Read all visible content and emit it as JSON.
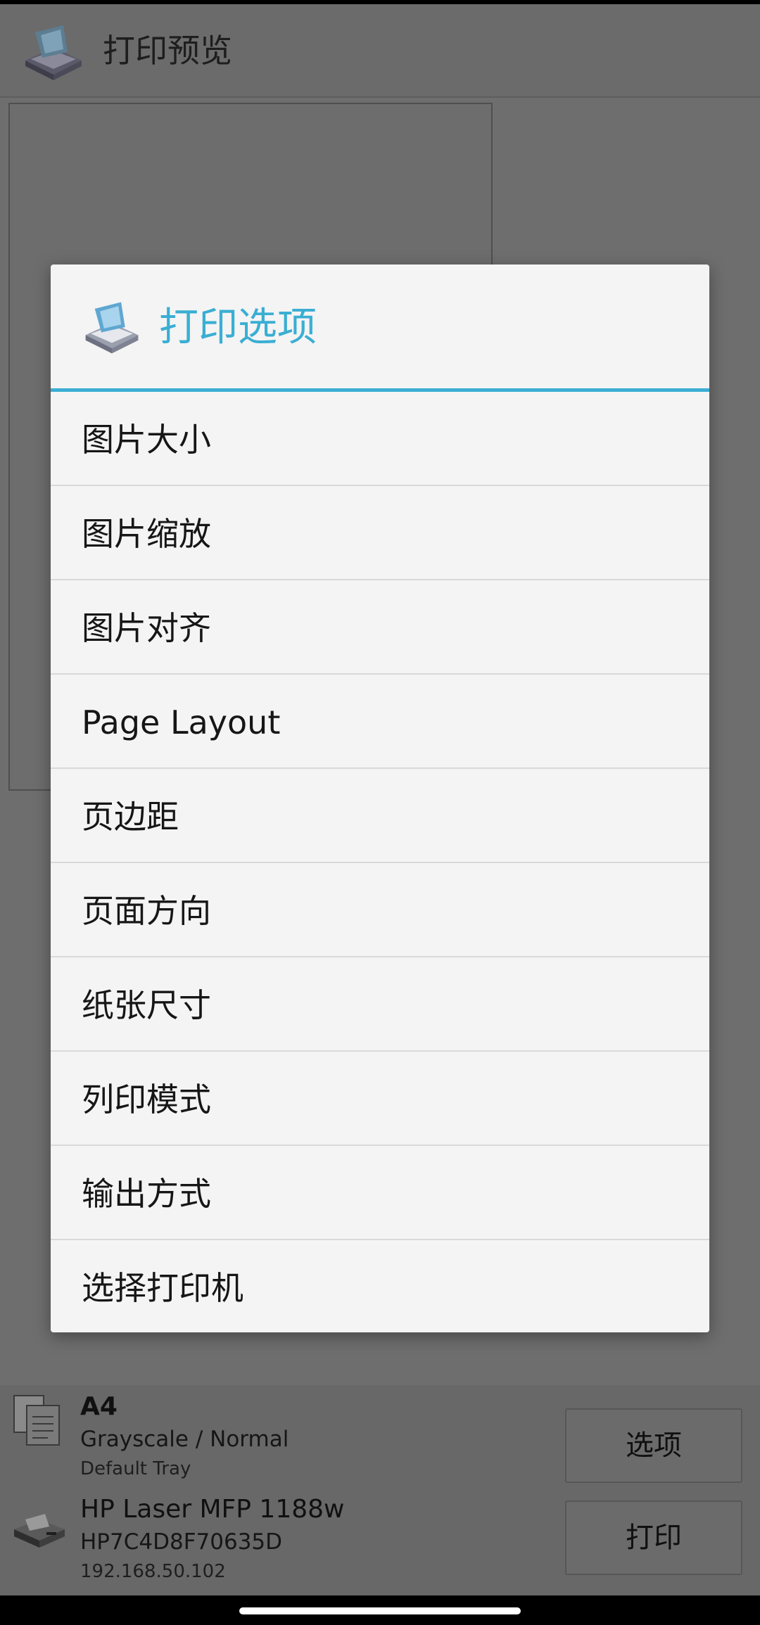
{
  "app": {
    "title": "打印预览",
    "icon": "printer-app-icon"
  },
  "dialog": {
    "title": "打印选项",
    "icon": "printer-app-icon",
    "accent_color": "#3aaed3",
    "items": [
      {
        "label": "图片大小"
      },
      {
        "label": "图片缩放"
      },
      {
        "label": "图片对齐"
      },
      {
        "label": "Page Layout"
      },
      {
        "label": "页边距"
      },
      {
        "label": "页面方向"
      },
      {
        "label": "纸张尺寸"
      },
      {
        "label": "列印模式"
      },
      {
        "label": "输出方式"
      },
      {
        "label": "选择打印机"
      }
    ]
  },
  "paper": {
    "size": "A4",
    "mode": "Grayscale / Normal",
    "tray": "Default Tray",
    "icon": "document-icon"
  },
  "printer": {
    "name": "HP Laser MFP 1188w",
    "id": "HP7C4D8F70635D",
    "ip": "192.168.50.102",
    "icon": "printer-icon"
  },
  "buttons": {
    "options_label": "选项",
    "print_label": "打印"
  }
}
